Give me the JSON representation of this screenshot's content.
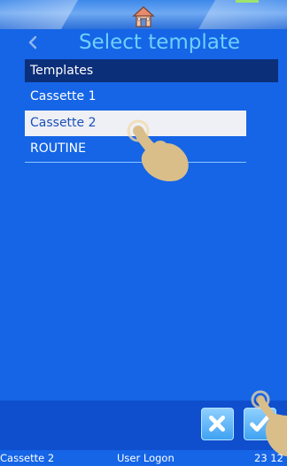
{
  "header": {
    "title": "Select template"
  },
  "templates": {
    "heading": "Templates",
    "items": [
      {
        "label": "Cassette 1",
        "selected": false
      },
      {
        "label": "Cassette 2",
        "selected": true
      },
      {
        "label": "ROUTINE",
        "selected": false
      }
    ]
  },
  "footer": {
    "current_template": "Cassette 2",
    "user_status": "User Logon",
    "time": "23 12"
  },
  "colors": {
    "background": "#1565e6",
    "title": "#6fd0ff",
    "list_header": "#0c2f7a",
    "selected_row": "#eef0f6",
    "button": "#3fa2f2"
  },
  "icons": [
    "home-icon",
    "back-icon",
    "cancel-icon",
    "confirm-icon",
    "pointing-hand-icon"
  ]
}
